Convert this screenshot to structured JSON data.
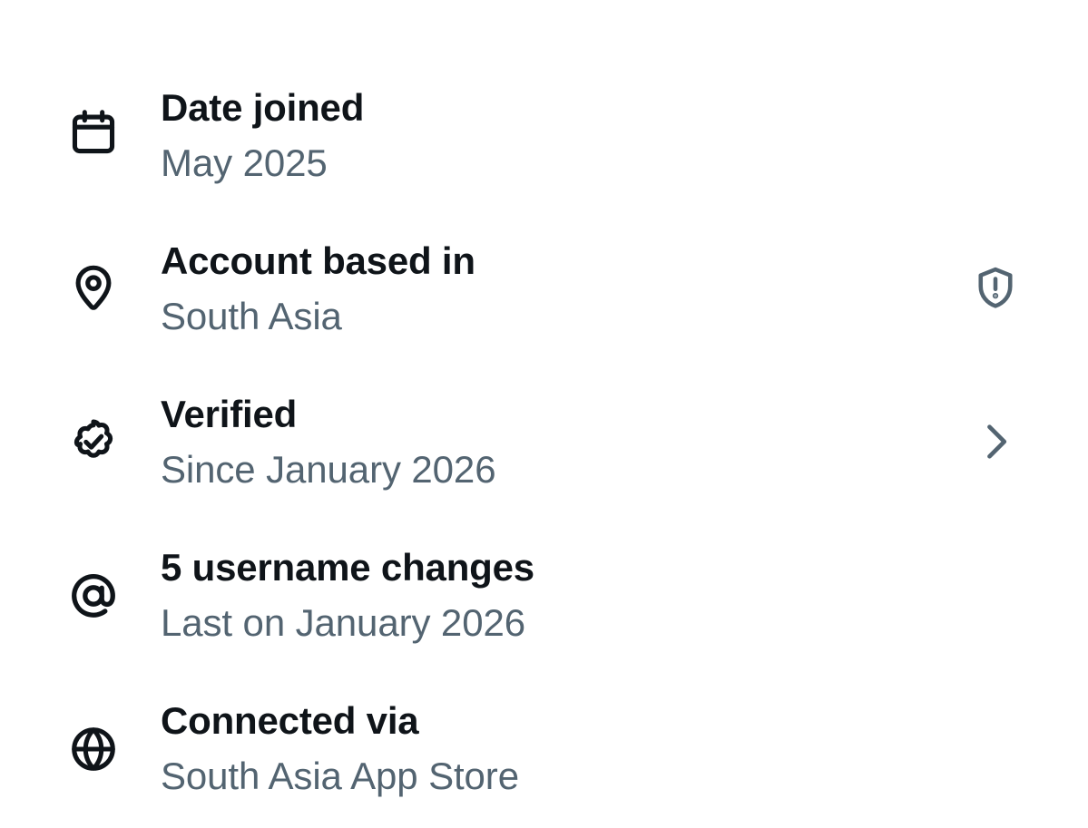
{
  "items": [
    {
      "icon": "calendar-icon",
      "title": "Date joined",
      "subtitle": "May 2025"
    },
    {
      "icon": "location-pin-icon",
      "title": "Account based in",
      "subtitle": "South Asia",
      "trailing_icon": "shield-alert-icon"
    },
    {
      "icon": "verified-badge-icon",
      "title": "Verified",
      "subtitle": "Since January 2026",
      "trailing_icon": "chevron-right-icon"
    },
    {
      "icon": "at-sign-icon",
      "title": "5 username changes",
      "subtitle": "Last on January 2026"
    },
    {
      "icon": "globe-icon",
      "title": "Connected via",
      "subtitle": "South Asia App Store"
    }
  ],
  "colors": {
    "primary_text": "#0f1419",
    "secondary_text": "#536471",
    "icon": "#0f1419",
    "trailing_icon": "#536471",
    "background": "#ffffff"
  }
}
